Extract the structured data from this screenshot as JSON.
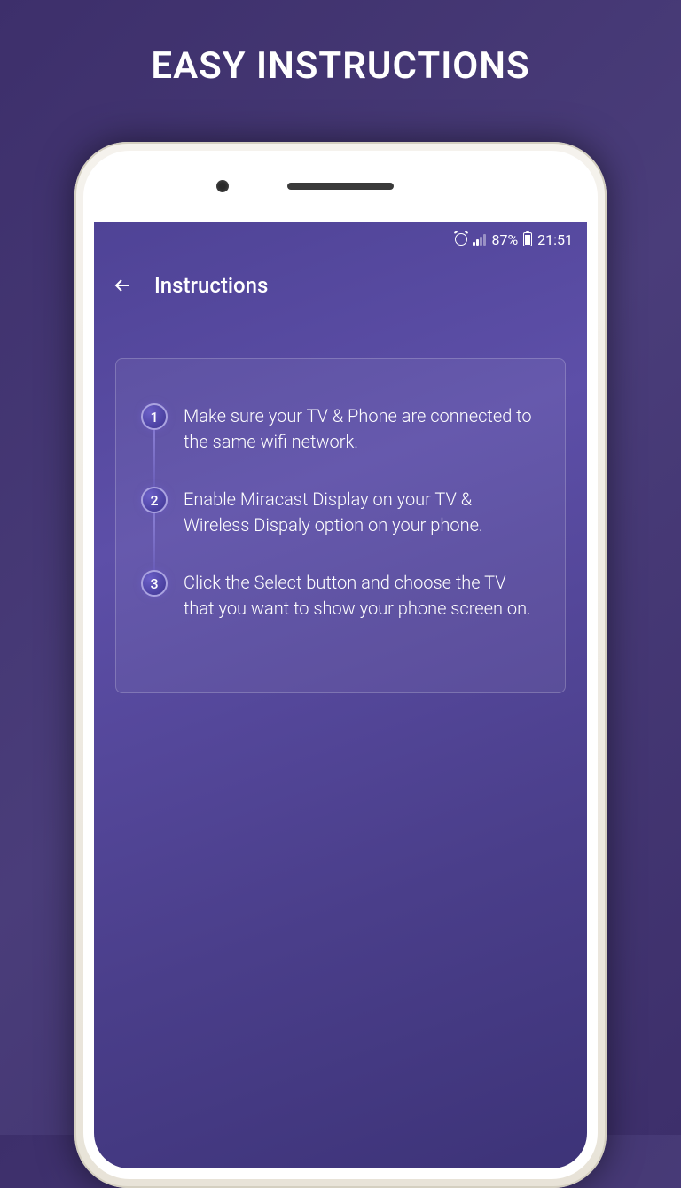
{
  "banner": {
    "title": "EASY INSTRUCTIONS"
  },
  "status_bar": {
    "battery_pct": "87%",
    "time": "21:51"
  },
  "app_bar": {
    "title": "Instructions"
  },
  "steps": [
    {
      "num": "1",
      "text": "Make sure your TV & Phone are connected to the same wifi network."
    },
    {
      "num": "2",
      "text": "Enable Miracast Display on your TV & Wireless Dispaly option on your phone."
    },
    {
      "num": "3",
      "text": "Click the Select button and choose the TV that you want to show your phone screen on."
    }
  ]
}
